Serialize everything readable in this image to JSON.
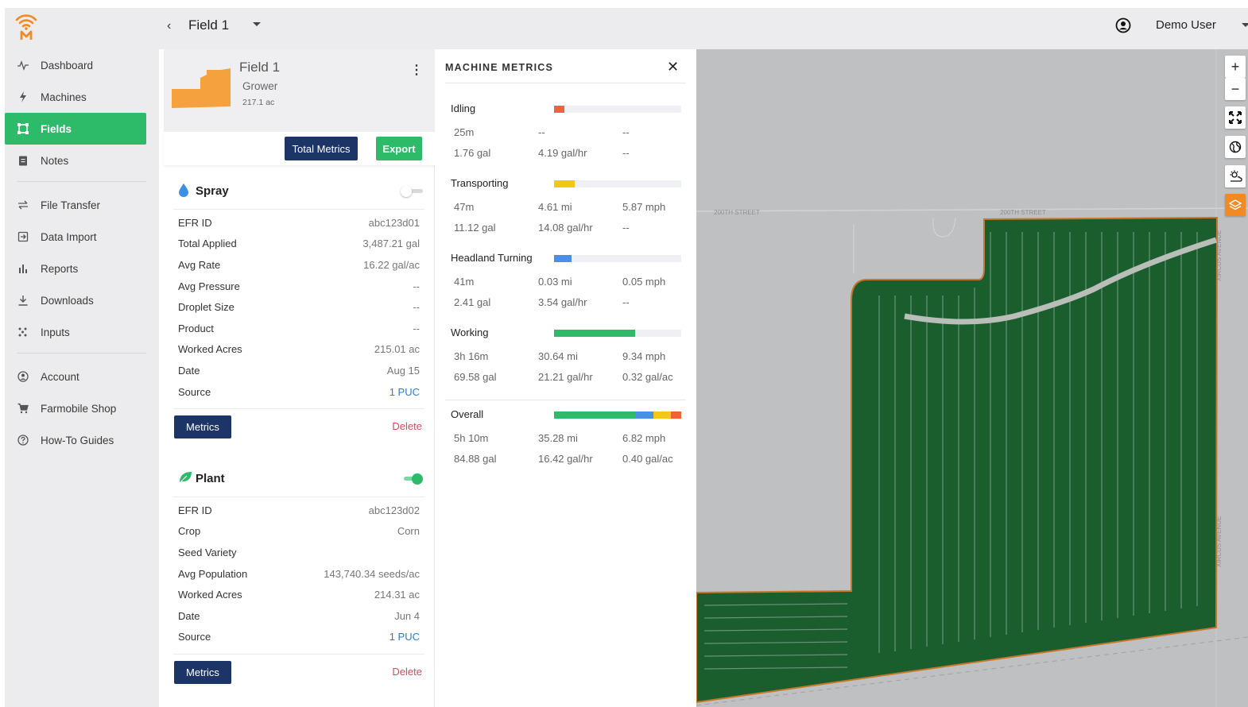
{
  "app": {
    "brand_color": "#f18a22",
    "accent": "#2dbb6a",
    "navy": "#1d3466"
  },
  "sidebar": {
    "items": [
      {
        "label": "Dashboard",
        "icon": "activity-icon"
      },
      {
        "label": "Machines",
        "icon": "bolt-icon"
      },
      {
        "label": "Fields",
        "icon": "field-polygon-icon",
        "active": true
      },
      {
        "label": "Notes",
        "icon": "clipboard-icon"
      },
      {
        "label": "File Transfer",
        "icon": "transfer-icon"
      },
      {
        "label": "Data Import",
        "icon": "import-icon"
      },
      {
        "label": "Reports",
        "icon": "bar-chart-icon"
      },
      {
        "label": "Downloads",
        "icon": "download-icon"
      },
      {
        "label": "Inputs",
        "icon": "seeds-icon"
      },
      {
        "label": "Account",
        "icon": "user-circle-icon"
      },
      {
        "label": "Farmobile Shop",
        "icon": "cart-icon"
      },
      {
        "label": "How-To Guides",
        "icon": "help-icon"
      }
    ]
  },
  "topbar": {
    "field_name": "Field 1",
    "user_name": "Demo User"
  },
  "field": {
    "name": "Field 1",
    "grower": "Grower",
    "acres": "217.1 ac",
    "total_metrics_label": "Total Metrics",
    "export_label": "Export"
  },
  "spray": {
    "title": "Spray",
    "enabled": false,
    "rows": [
      {
        "k": "EFR ID",
        "v": "abc123d01"
      },
      {
        "k": "Total Applied",
        "v": "3,487.21 gal"
      },
      {
        "k": "Avg Rate",
        "v": "16.22 gal/ac"
      },
      {
        "k": "Avg Pressure",
        "v": "--"
      },
      {
        "k": "Droplet Size",
        "v": "--"
      },
      {
        "k": "Product",
        "v": "--"
      },
      {
        "k": "Worked Acres",
        "v": "215.01 ac"
      },
      {
        "k": "Date",
        "v": "Aug 15"
      },
      {
        "k": "Source",
        "v": "1 PUC"
      }
    ],
    "metrics_label": "Metrics",
    "delete_label": "Delete"
  },
  "plant": {
    "title": "Plant",
    "enabled": true,
    "rows": [
      {
        "k": "EFR ID",
        "v": "abc123d02"
      },
      {
        "k": "Crop",
        "v": "Corn"
      },
      {
        "k": "Seed Variety",
        "v": ""
      },
      {
        "k": "Avg Population",
        "v": "143,740.34 seeds/ac"
      },
      {
        "k": "Worked Acres",
        "v": "214.31 ac"
      },
      {
        "k": "Date",
        "v": "Jun 4"
      },
      {
        "k": "Source",
        "v": "1 PUC"
      }
    ],
    "metrics_label": "Metrics",
    "delete_label": "Delete"
  },
  "metrics": {
    "title": "MACHINE METRICS",
    "groups": [
      {
        "label": "Idling",
        "bar": [
          {
            "frac": 0.08,
            "color": "#ef6434"
          }
        ],
        "row1": [
          "25m",
          "--",
          "--"
        ],
        "row2": [
          "1.76 gal",
          "4.19 gal/hr",
          "--"
        ]
      },
      {
        "label": "Transporting",
        "bar": [
          {
            "frac": 0.16,
            "color": "#f5c518"
          }
        ],
        "row1": [
          "47m",
          "4.61 mi",
          "5.87 mph"
        ],
        "row2": [
          "11.12 gal",
          "14.08 gal/hr",
          "--"
        ]
      },
      {
        "label": "Headland Turning",
        "bar": [
          {
            "frac": 0.14,
            "color": "#4a8fe8"
          }
        ],
        "row1": [
          "41m",
          "0.03 mi",
          "0.05 mph"
        ],
        "row2": [
          "2.41 gal",
          "3.54 gal/hr",
          "--"
        ]
      },
      {
        "label": "Working",
        "bar": [
          {
            "frac": 0.64,
            "color": "#2dbb6a"
          }
        ],
        "row1": [
          "3h 16m",
          "30.64 mi",
          "9.34 mph"
        ],
        "row2": [
          "69.58 gal",
          "21.21 gal/hr",
          "0.32 gal/ac"
        ]
      },
      {
        "label": "Overall",
        "bar": [
          {
            "frac": 0.64,
            "color": "#2dbb6a"
          },
          {
            "frac": 0.14,
            "color": "#4a8fe8"
          },
          {
            "frac": 0.14,
            "color": "#f5c518"
          },
          {
            "frac": 0.08,
            "color": "#ef6434"
          }
        ],
        "row1": [
          "5h 10m",
          "35.28 mi",
          "6.82 mph"
        ],
        "row2": [
          "84.88 gal",
          "16.42 gal/hr",
          "0.40 gal/ac"
        ]
      }
    ]
  },
  "map": {
    "street_top_left": "200TH STREET",
    "street_top_right": "200TH STREET",
    "street_right_upper": "XIRCUS AVENUE",
    "street_right_lower": "XIRCUS AVENUE",
    "controls": [
      "zoom-in-icon",
      "zoom-out-icon",
      "fullscreen-icon",
      "globe-icon",
      "weather-icon",
      "layers-icon"
    ]
  }
}
